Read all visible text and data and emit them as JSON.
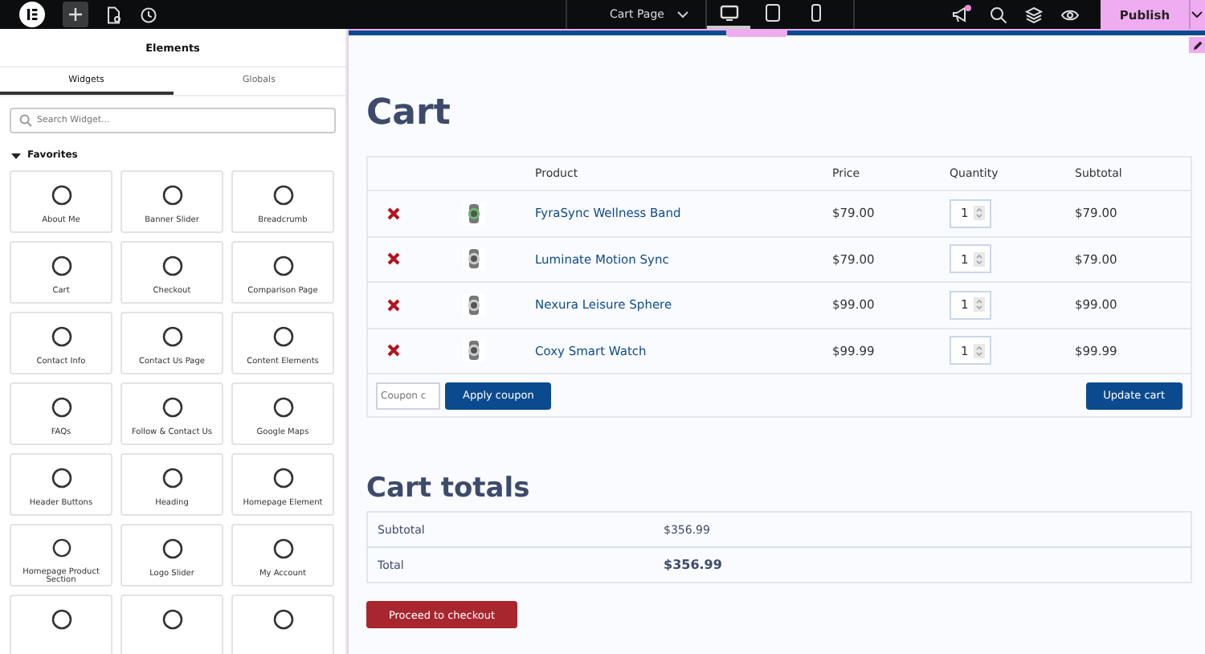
{
  "topbar": {
    "page_title": "Cart Page",
    "devices": [
      {
        "kind": "desktop",
        "selected": true
      },
      {
        "kind": "tablet",
        "selected": false
      },
      {
        "kind": "mobile",
        "selected": false
      }
    ],
    "notification": true,
    "publish": "Publish"
  },
  "panel": {
    "title": "Elements",
    "tabs": [
      {
        "label": "Widgets",
        "selected": true
      },
      {
        "label": "Globals",
        "selected": false
      }
    ],
    "search": {
      "placeholder": "Search Widget..."
    },
    "section": {
      "label": "Favorites",
      "expanded": true
    },
    "widgets": [
      {
        "label": "About Me"
      },
      {
        "label": "Banner Slider"
      },
      {
        "label": "Breadcrumb"
      },
      {
        "label": "Cart"
      },
      {
        "label": "Checkout"
      },
      {
        "label": "Comparison Page"
      },
      {
        "label": "Contact Info"
      },
      {
        "label": "Contact Us Page"
      },
      {
        "label": "Content Elements"
      },
      {
        "label": "FAQs"
      },
      {
        "label": "Follow & Contact Us"
      },
      {
        "label": "Google Maps"
      },
      {
        "label": "Header Buttons"
      },
      {
        "label": "Heading"
      },
      {
        "label": "Homepage Element"
      },
      {
        "label": "Homepage Product Section"
      },
      {
        "label": "Logo Slider"
      },
      {
        "label": "My Account"
      },
      {
        "kind": "widget"
      },
      {
        "kind": "widget"
      },
      {
        "kind": "widget"
      }
    ]
  },
  "page": {
    "title": "Cart",
    "table": {
      "columns": [
        "Product",
        "Price",
        "Quantity",
        "Subtotal"
      ],
      "rows": [
        {
          "product": "FyraSync Wellness Band",
          "price": "$79.00",
          "quantity": "1",
          "subtotal": "$79.00"
        },
        {
          "product": "Luminate Motion Sync",
          "price": "$79.00",
          "quantity": "1",
          "subtotal": "$79.00"
        },
        {
          "product": "Nexura Leisure Sphere",
          "price": "$99.00",
          "quantity": "1",
          "subtotal": "$99.00"
        },
        {
          "product": "Coxy Smart Watch",
          "price": "$99.99",
          "quantity": "1",
          "subtotal": "$99.99"
        }
      ]
    },
    "coupon": {
      "placeholder": "Coupon c"
    },
    "apply_button": "Apply coupon",
    "update_button": "Update cart",
    "totals_title": "Cart totals",
    "totals": [
      {
        "label": "Subtotal",
        "value": "$356.99",
        "kind": "normal"
      },
      {
        "label": "Total",
        "value": "$356.99",
        "kind": "grand"
      }
    ],
    "checkout_button": "Proceed to checkout"
  }
}
